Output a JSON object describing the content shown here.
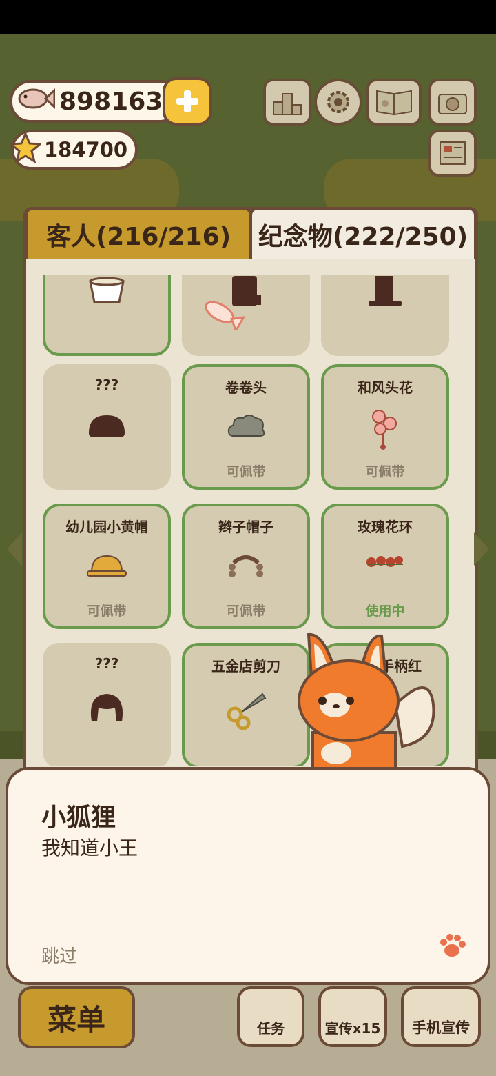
{
  "currency": {
    "fish": "8981636",
    "stars": "184700"
  },
  "tabs": [
    {
      "label": "客人(216/216)",
      "active": false
    },
    {
      "label": "纪念物(222/250)",
      "active": true
    }
  ],
  "cards": [
    {
      "name": "",
      "status": "",
      "owned": true,
      "icon": "cup-icon"
    },
    {
      "name": "",
      "status": "",
      "owned": false,
      "icon": "hat-icon"
    },
    {
      "name": "",
      "status": "",
      "owned": false,
      "icon": "top-hat-icon"
    },
    {
      "name": "???",
      "status": "",
      "owned": false,
      "icon": "hair-silhouette-icon"
    },
    {
      "name": "卷卷头",
      "status": "可佩带",
      "owned": true,
      "icon": "curly-hair-icon"
    },
    {
      "name": "和风头花",
      "status": "可佩带",
      "owned": true,
      "icon": "flower-hairpin-icon"
    },
    {
      "name": "幼儿园小黄帽",
      "status": "可佩带",
      "owned": true,
      "icon": "yellow-cap-icon"
    },
    {
      "name": "辫子帽子",
      "status": "可佩带",
      "owned": true,
      "icon": "braid-hat-icon"
    },
    {
      "name": "玫瑰花环",
      "status": "使用中",
      "owned": true,
      "icon": "rose-wreath-icon",
      "in_use": true
    },
    {
      "name": "???",
      "status": "",
      "owned": false,
      "icon": "wig-silhouette-icon"
    },
    {
      "name": "五金店剪刀",
      "status": "",
      "owned": true,
      "icon": "scissors-icon"
    },
    {
      "name": "手柄红",
      "status": "",
      "owned": true,
      "icon": "unknown-icon"
    }
  ],
  "dialog": {
    "speaker": "小狐狸",
    "text": "我知道小王",
    "skip": "跳过"
  },
  "bottom": {
    "menu": "菜单",
    "task": "任务",
    "promo": "宣传x15",
    "phone_promo": "手机宣传"
  },
  "colors": {
    "accent_gold": "#c69a2c",
    "owned_border": "#6a9a4c",
    "fox_orange": "#f07b2c"
  }
}
